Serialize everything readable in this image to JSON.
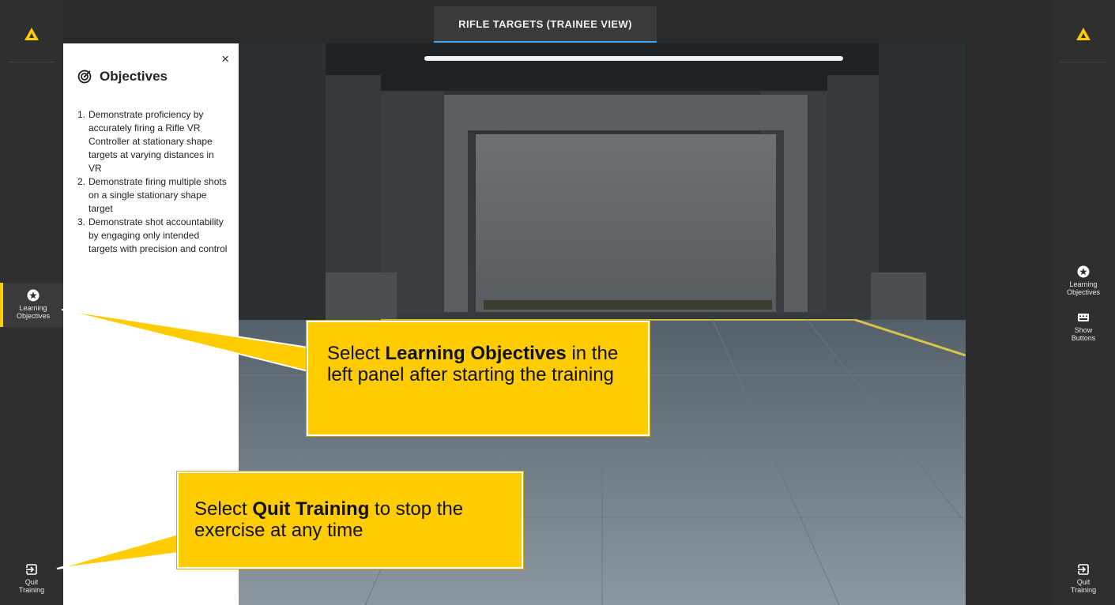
{
  "header": {
    "tab_label": "RIFLE TARGETS (TRAINEE VIEW)"
  },
  "left_rail": {
    "learning_objectives": [
      "Learning",
      "Objectives"
    ],
    "quit_training": [
      "Quit",
      "Training"
    ]
  },
  "right_rail": {
    "learning_objectives": [
      "Learning",
      "Objectives"
    ],
    "show_buttons": [
      "Show",
      "Buttons"
    ],
    "quit_training": [
      "Quit",
      "Training"
    ]
  },
  "objectives_panel": {
    "close_glyph": "×",
    "title": "Objectives",
    "items": [
      {
        "num": "1.",
        "text": "Demonstrate proficiency by accurately firing a Rifle VR Controller at stationary shape targets at varying distances in VR"
      },
      {
        "num": "2.",
        "text": "Demonstrate firing multiple shots on a single stationary shape target"
      },
      {
        "num": "3.",
        "text": "Demonstrate shot accountability by engaging only intended targets with precision and control"
      }
    ]
  },
  "callouts": {
    "learning": {
      "pre": "Select ",
      "bold": "Learning Objectives",
      "post": " in the left panel after starting the training"
    },
    "quit": {
      "pre": "Select ",
      "bold": "Quit Training",
      "post": " to stop the exercise at any time"
    }
  },
  "colors": {
    "accent": "#ffcc00",
    "tab_underline": "#3fa3e8",
    "rail": "#2f2f2f"
  },
  "icons": {
    "logo": "warning-triangle-icon",
    "learning": "star-badge-icon",
    "show_buttons": "keyboard-icon",
    "quit": "exit-icon",
    "objectives": "target-icon"
  }
}
